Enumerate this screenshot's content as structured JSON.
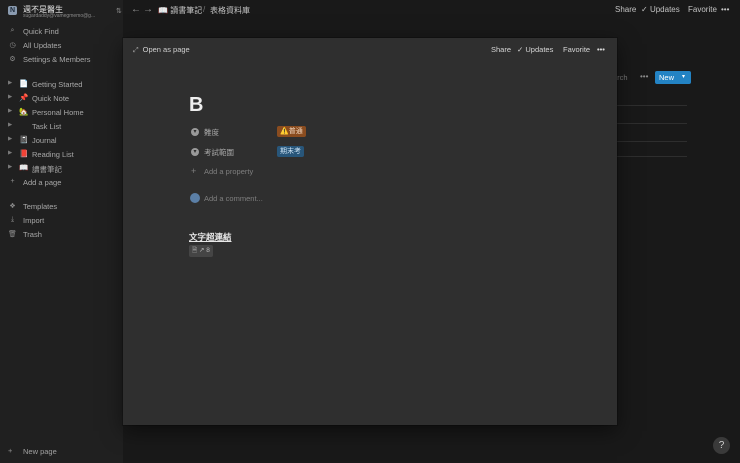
{
  "workspace": {
    "name": "週不是醫生",
    "email": "sugardaddy@vamegmemo@g..."
  },
  "sidebar": {
    "nav": [
      {
        "icon": "search-icon",
        "label": "Quick Find"
      },
      {
        "icon": "clock-icon",
        "label": "All Updates"
      },
      {
        "icon": "gear-icon",
        "label": "Settings & Members"
      }
    ],
    "pages": [
      {
        "emoji": "📄",
        "label": "Getting Started"
      },
      {
        "emoji": "📌",
        "label": "Quick Note"
      },
      {
        "emoji": "🏡",
        "label": "Personal Home"
      },
      {
        "emoji": "",
        "label": "Task List"
      },
      {
        "emoji": "📓",
        "label": "Journal"
      },
      {
        "emoji": "📕",
        "label": "Reading List"
      },
      {
        "emoji": "📖",
        "label": "讀書筆記"
      }
    ],
    "add_page": "Add a page",
    "tools": [
      {
        "icon": "template-icon",
        "label": "Templates"
      },
      {
        "icon": "import-icon",
        "label": "Import"
      },
      {
        "icon": "trash-icon",
        "label": "Trash"
      }
    ],
    "new_page": "New page"
  },
  "topbar": {
    "crumb1_icon": "📖",
    "crumb1": "讀書筆記",
    "sep": "/",
    "crumb2": "表格資料庫",
    "share": "Share",
    "updates": "Updates",
    "favorite": "Favorite",
    "more": "•••"
  },
  "background": {
    "search": "arch",
    "dots": "•••",
    "new_button": "New"
  },
  "modal": {
    "open_as_page": "Open as page",
    "share": "Share",
    "updates": "Updates",
    "favorite": "Favorite",
    "more": "•••",
    "title": "B",
    "properties": [
      {
        "name": "難度",
        "value": "⚠️普通",
        "color": "#8a4c1f"
      },
      {
        "name": "考試範圍",
        "value": "期末考",
        "color": "#28567a"
      }
    ],
    "add_property": "Add a property",
    "add_comment": "Add a comment...",
    "link_title": "文字超連結",
    "mini_label": "8"
  },
  "help": "?"
}
